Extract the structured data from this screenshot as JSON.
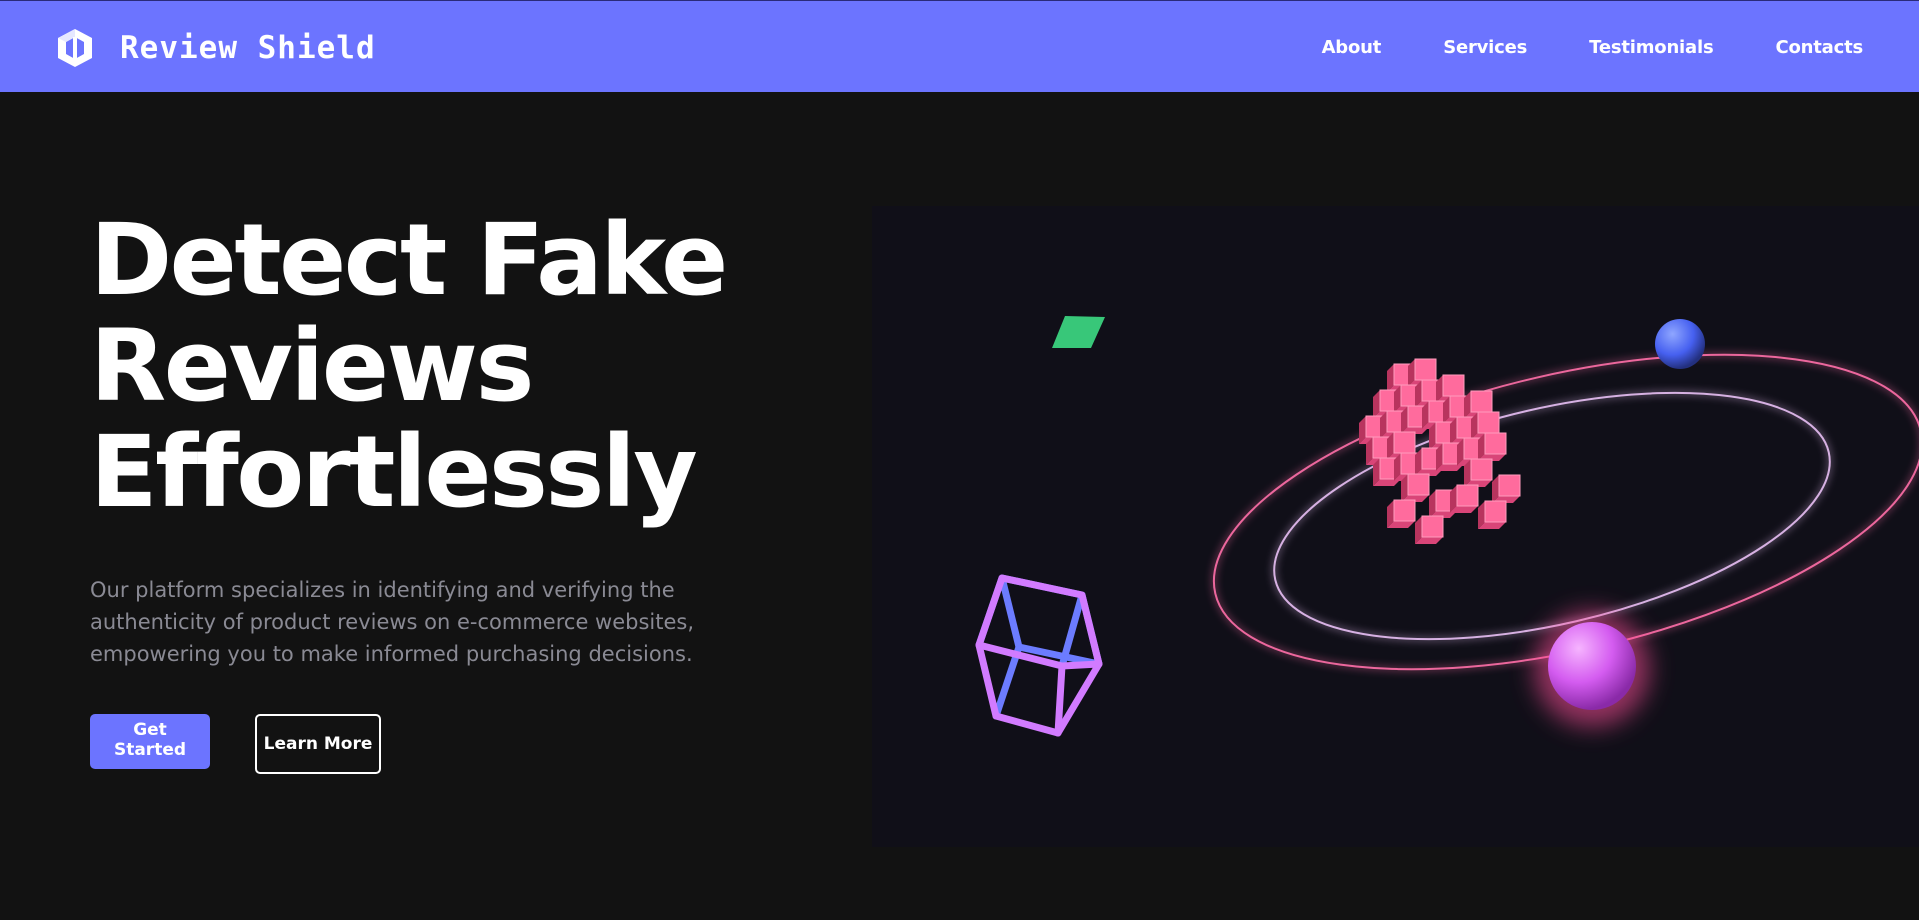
{
  "header": {
    "brand_name": "Review Shield",
    "logo_icon": "hexagon-shield-logo",
    "nav": [
      "About",
      "Services",
      "Testimonials",
      "Contacts"
    ]
  },
  "hero": {
    "title_lines": [
      "Detect Fake",
      "Reviews",
      "Effortlessly"
    ],
    "description": "Our platform specializes in identifying and verifying the authenticity of product reviews on e-commerce websites, empowering you to make informed purchasing decisions.",
    "primary_button": "Get Started",
    "secondary_button": "Learn More"
  },
  "colors": {
    "accent": "#6c74ff",
    "background": "#121212",
    "illustration_bg": "#100f18",
    "text_muted": "#8a8a94",
    "pink": "#ff5f93",
    "violet": "#d27bff",
    "blue": "#4c6cff",
    "green": "#3ddc84"
  }
}
